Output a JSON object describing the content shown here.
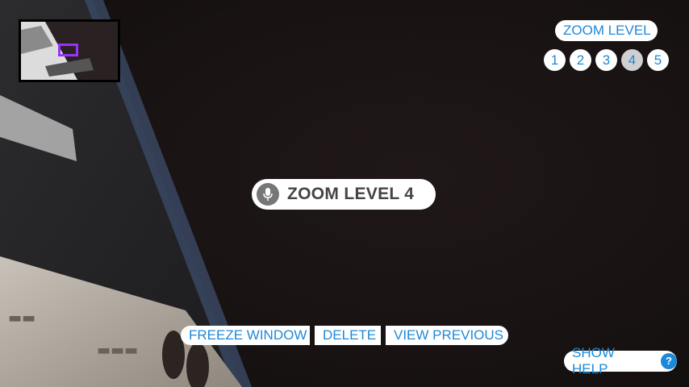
{
  "zoom_panel": {
    "title": "ZOOM LEVEL",
    "levels": [
      "1",
      "2",
      "3",
      "4",
      "5"
    ],
    "active_level": "4"
  },
  "voice_feedback": {
    "text": "ZOOM LEVEL 4",
    "icon": "microphone-icon"
  },
  "actions": {
    "freeze": "FREEZE WINDOW",
    "delete": "DELETE",
    "previous": "VIEW PREVIOUS"
  },
  "help": {
    "label": "SHOW HELP",
    "icon_glyph": "?"
  },
  "colors": {
    "accent": "#1e88d8",
    "minimap_frame": "#9b30ff"
  }
}
